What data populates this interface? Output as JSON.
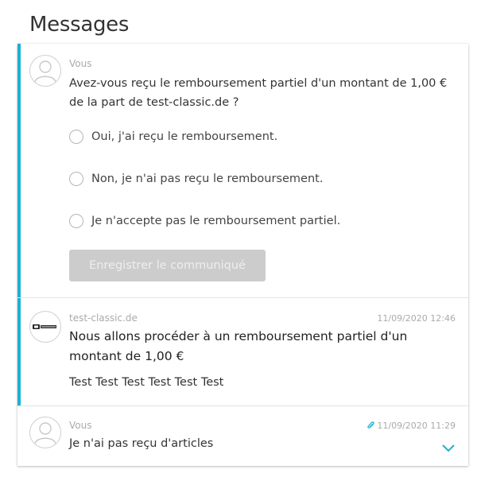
{
  "page": {
    "title": "Messages"
  },
  "colors": {
    "accent": "#1eb0d4",
    "button_disabled_bg": "#cccccc"
  },
  "messages": [
    {
      "sender": "Vous",
      "avatar_icon": "user-avatar-icon",
      "question": "Avez-vous reçu le remboursement partiel d'un montant de 1,00 € de la part de test-classic.de ?",
      "options": [
        {
          "label": "Oui, j'ai reçu le remboursement."
        },
        {
          "label": "Non, je n'ai pas reçu le remboursement."
        },
        {
          "label": "Je n'accepte pas le remboursement partiel."
        }
      ],
      "save_button": "Enregistrer le communiqué"
    },
    {
      "sender": "test-classic.de",
      "avatar_icon": "merchant-logo-icon",
      "timestamp": "11/09/2020 12:46",
      "title": "Nous allons procéder à un remboursement partiel d'un montant de 1,00 €",
      "body": "Test Test Test Test Test Test"
    },
    {
      "sender": "Vous",
      "avatar_icon": "user-avatar-icon",
      "timestamp": "11/09/2020 11:29",
      "attachment_icon": "paperclip-icon",
      "preview": "Je n'ai pas reçu d'articles",
      "expand_icon": "chevron-down-icon"
    }
  ]
}
